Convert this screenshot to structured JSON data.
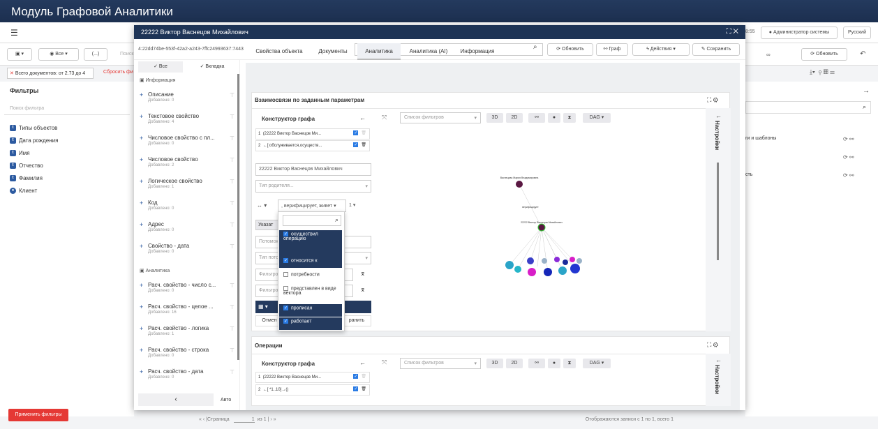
{
  "app": {
    "title": "Модуль Графовой Аналитики"
  },
  "bg": {
    "time": "8:55",
    "admin": "Администратор системы",
    "lang": "Русский",
    "docs": "Всего документов: от 2.73 до 4",
    "reset": "Сбросить фи",
    "all": "Все",
    "dots": "(...)",
    "search_fragment": "Поиск",
    "refresh": "Обновить",
    "filters_title": "Фильтры",
    "filter_search": "Поиск фильтра",
    "filters": [
      "Типы объектов",
      "Дата рождения",
      "Имя",
      "Отчество",
      "Фамилия",
      "Клиент"
    ],
    "apply": "Применить фильтры",
    "right_row1": "ги и шаблоны",
    "right_row3": "сть",
    "infinity": "∞",
    "pager": {
      "page": "Страница",
      "num": "1",
      "of": "из 1",
      "info": "Отображаются записи с 1 по 1, всего 1"
    }
  },
  "modal": {
    "title": "22222 Виктор Васнецов Михайлович",
    "id": "4:22dd74be-553f-42a2-a243-7ffc24993637:7443",
    "search_placeholder": "Поиск свойств",
    "buttons": {
      "refresh": "Обновить",
      "graph": "Граф",
      "actions": "Действия",
      "save": "Сохранить"
    },
    "left": {
      "tab_all": "Все",
      "tab_tab": "Вкладка",
      "sec_info": "Информация",
      "sec_analytics": "Аналитика",
      "auto": "Авто",
      "items": [
        {
          "name": "Описание",
          "sub": "Добавлено: 0"
        },
        {
          "name": "Текстовое свойство",
          "sub": "Добавлено: 4"
        },
        {
          "name": "Числовое свойство с пл...",
          "sub": "Добавлено: 0"
        },
        {
          "name": "Числовое свойство",
          "sub": "Добавлено: 2"
        },
        {
          "name": "Логическое свойство",
          "sub": "Добавлено: 1"
        },
        {
          "name": "Код",
          "sub": "Добавлено: 0"
        },
        {
          "name": "Адрес",
          "sub": "Добавлено: 0"
        },
        {
          "name": "Свойство - дата",
          "sub": "Добавлено: 0"
        }
      ],
      "items2": [
        {
          "name": "Расч. свойство - число с...",
          "sub": "Добавлено: 0"
        },
        {
          "name": "Расч. свойство - целое ...",
          "sub": "Добавлено: 16"
        },
        {
          "name": "Расч. свойство - логика",
          "sub": "Добавлено: 1"
        },
        {
          "name": "Расч. свойство - строка",
          "sub": "Добавлено: 0"
        },
        {
          "name": "Расч. свойство - дата",
          "sub": "Добавлено: 0"
        }
      ]
    },
    "tabs": [
      "Свойства объекта",
      "Документы",
      "Аналитика",
      "Аналитика (AI)",
      "Информация"
    ],
    "card1": {
      "title": "Взаимосвязи по заданным параметрам",
      "builder": "Конструктор графа",
      "filter_list": "Список фильтров",
      "b3d": "3D",
      "b2d": "2D",
      "dag": "DAG",
      "settings": "Настройки",
      "rows": [
        {
          "n": "1",
          "t": "(22222 Виктор Васнецов Ми..."
        },
        {
          "n": "2",
          "t": "←[:обслуживается,осуществ..."
        }
      ],
      "name_value": "22222 Виктор Васнецов Михайлович",
      "parent_type": "Тип родителя...",
      "rel_value": ", верифицирует, живет",
      "rel_num": "1",
      "specify": "Указат",
      "child": "Потомок",
      "child_type": "Тип пото",
      "filter1": "Фильтро",
      "filter2": "Фильтро",
      "cancel": "Отмен",
      "apply": "ранить",
      "dropdown": [
        {
          "label": "осуществил операцию",
          "on": true
        },
        {
          "label": "относится к",
          "on": true
        },
        {
          "label": "потребности",
          "on": false
        },
        {
          "label": "представлен в виде вектора",
          "on": false
        },
        {
          "label": "прописан",
          "on": true
        },
        {
          "label": "работает",
          "on": true
        }
      ],
      "graph": {
        "top_label": "Васнецова Мария Владимировна",
        "mid_label": "верифицирует",
        "center_label": "22222 Виктор Васнецов Михайлович"
      }
    },
    "card2": {
      "title": "Операции",
      "builder": "Конструктор графа",
      "filter_list": "Список фильтров",
      "b3d": "3D",
      "b2d": "2D",
      "dag": "DAG",
      "settings": "Настройки",
      "rows": [
        {
          "n": "1",
          "t": "(22222 Виктор Васнецов Ми..."
        },
        {
          "n": "2",
          "t": "←[ *1..10]→()"
        }
      ]
    }
  },
  "colors": {
    "header": "#1e3456",
    "accent": "#2a7be4",
    "danger": "#e53935"
  }
}
